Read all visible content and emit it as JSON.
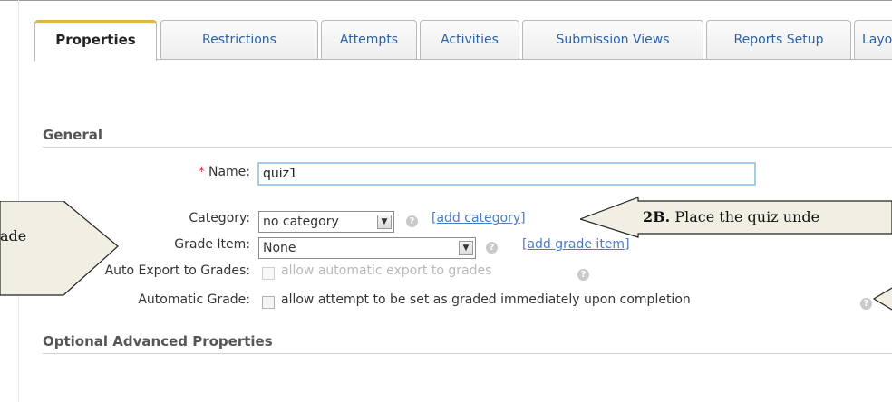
{
  "tabs": [
    {
      "label": "Properties",
      "active": true
    },
    {
      "label": "Restrictions"
    },
    {
      "label": "Attempts"
    },
    {
      "label": "Activities"
    },
    {
      "label": "Submission Views"
    },
    {
      "label": "Reports Setup"
    },
    {
      "label": "Layout/"
    }
  ],
  "general": {
    "heading": "General",
    "required_marker": "*",
    "name_label": "Name:",
    "name_value": "quiz1",
    "category_label": "Category:",
    "category_value": "no category",
    "add_category_link": "[add category]",
    "grade_item_label": "Grade Item:",
    "grade_item_value": "None",
    "add_grade_item_link": "[add grade item]",
    "auto_export_label": "Auto Export to Grades:",
    "auto_export_option": "allow automatic export to grades",
    "automatic_grade_label": "Automatic Grade:",
    "automatic_grade_option": "allow attempt to be set as graded immediately upon completion"
  },
  "optional": {
    "heading": "Optional Advanced Properties"
  },
  "callouts": {
    "left_text": "ade",
    "right_bold": "2B.",
    "right_text": " Place the quiz unde"
  },
  "icons": {
    "help": "question-circle-icon",
    "dropdown": "chevron-down-icon"
  }
}
